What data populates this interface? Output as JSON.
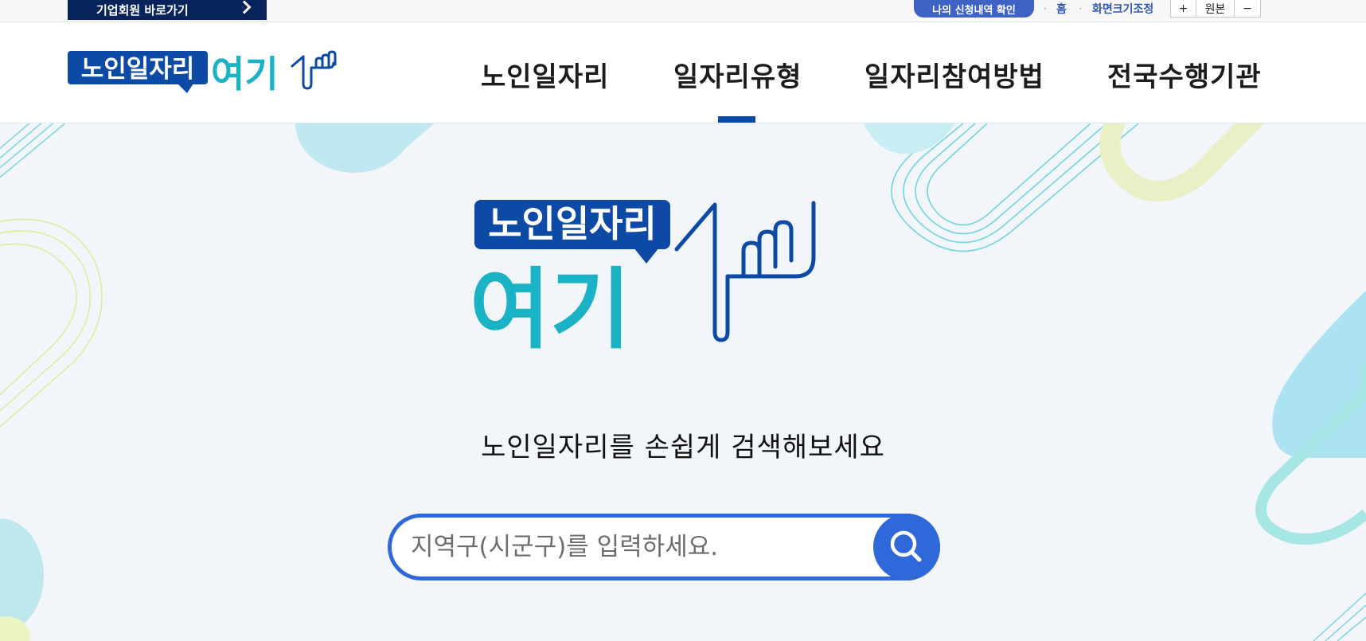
{
  "topbar": {
    "corp_link": "기업회원 바로가기",
    "apply_check": "나의 신청내역 확인",
    "home": "홈",
    "zoom_label": "화면크기조정",
    "zoom_in": "+",
    "zoom_reset": "원본",
    "zoom_out": "−"
  },
  "logo": {
    "line1": "노인일자리",
    "line2": "여기"
  },
  "gnb": {
    "items": [
      "노인일자리",
      "일자리유형",
      "일자리참여방법",
      "전국수행기관"
    ],
    "active_index": 1
  },
  "hero": {
    "tagline": "노인일자리를 손쉽게 검색해보세요",
    "search_placeholder": "지역구(시군구)를 입력하세요.",
    "search_value": ""
  },
  "colors": {
    "navy": "#06245b",
    "brand_blue": "#0c4aa6",
    "teal": "#1bb2c6",
    "search_blue": "#2f68d8"
  },
  "icons": [
    "chevron-right-icon",
    "search-icon",
    "hand-pointer-icon"
  ]
}
